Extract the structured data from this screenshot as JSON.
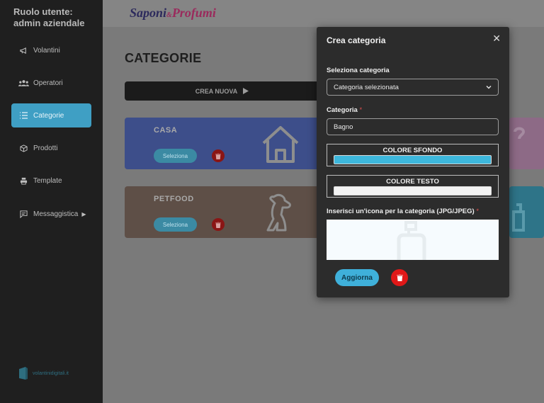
{
  "sidebar": {
    "role_line1": "Ruolo utente:",
    "role_line2": "admin aziendale",
    "items": [
      {
        "label": "Volantini",
        "icon": "megaphone-icon"
      },
      {
        "label": "Operatori",
        "icon": "users-icon"
      },
      {
        "label": "Categorie",
        "icon": "list-icon"
      },
      {
        "label": "Prodotti",
        "icon": "box-icon"
      },
      {
        "label": "Template",
        "icon": "printer-icon"
      },
      {
        "label": "Messaggistica",
        "icon": "chat-icon"
      }
    ],
    "footer_brand": "volantinidigitali.it"
  },
  "header": {
    "logo_part1": "Saponi",
    "logo_amp": "&",
    "logo_part2": "Profumi"
  },
  "main": {
    "title": "CATEGORIE",
    "create_label": "CREA NUOVA",
    "categories": [
      {
        "name": "CASA",
        "select_label": "Seleziona",
        "bg": "#3d4e8a",
        "color": "#a9a9a9",
        "icon": "house-icon"
      },
      {
        "name": "PETFOOD",
        "select_label": "Seleziona",
        "bg": "#5e4f47",
        "color": "#a9a9a9",
        "icon": "dog-icon"
      }
    ]
  },
  "modal": {
    "title": "Crea categoria",
    "select_label": "Seleziona categoria",
    "select_value": "Categoria selezionata",
    "name_label": "Categoria",
    "name_value": "Bagno",
    "bg_color_label": "COLORE SFONDO",
    "bg_color": "#3db7dc",
    "text_color_label": "COLORE TESTO",
    "text_color": "#f2f2f2",
    "icon_label": "Inserisci un'icona per la categoria (JPG/JPEG)",
    "update_label": "Aggiorna"
  }
}
